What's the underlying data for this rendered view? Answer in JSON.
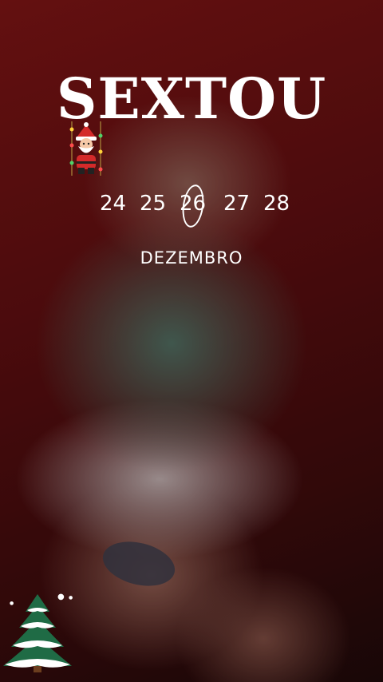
{
  "title": "SEXTOU",
  "dates": [
    {
      "label": "24",
      "highlighted": false
    },
    {
      "label": "25",
      "highlighted": false
    },
    {
      "label": "26",
      "highlighted": true
    },
    {
      "label": "27",
      "highlighted": false
    },
    {
      "label": "28",
      "highlighted": false
    }
  ],
  "month": "DEZEMBRO",
  "decorations": {
    "top_sticker": "santa-claus-icon",
    "bottom_sticker": "christmas-tree-icon"
  },
  "colors": {
    "text": "#ffffff",
    "background": "#5c0e10",
    "accent_red": "#d42a2a",
    "tree_green": "#1f6b45"
  }
}
